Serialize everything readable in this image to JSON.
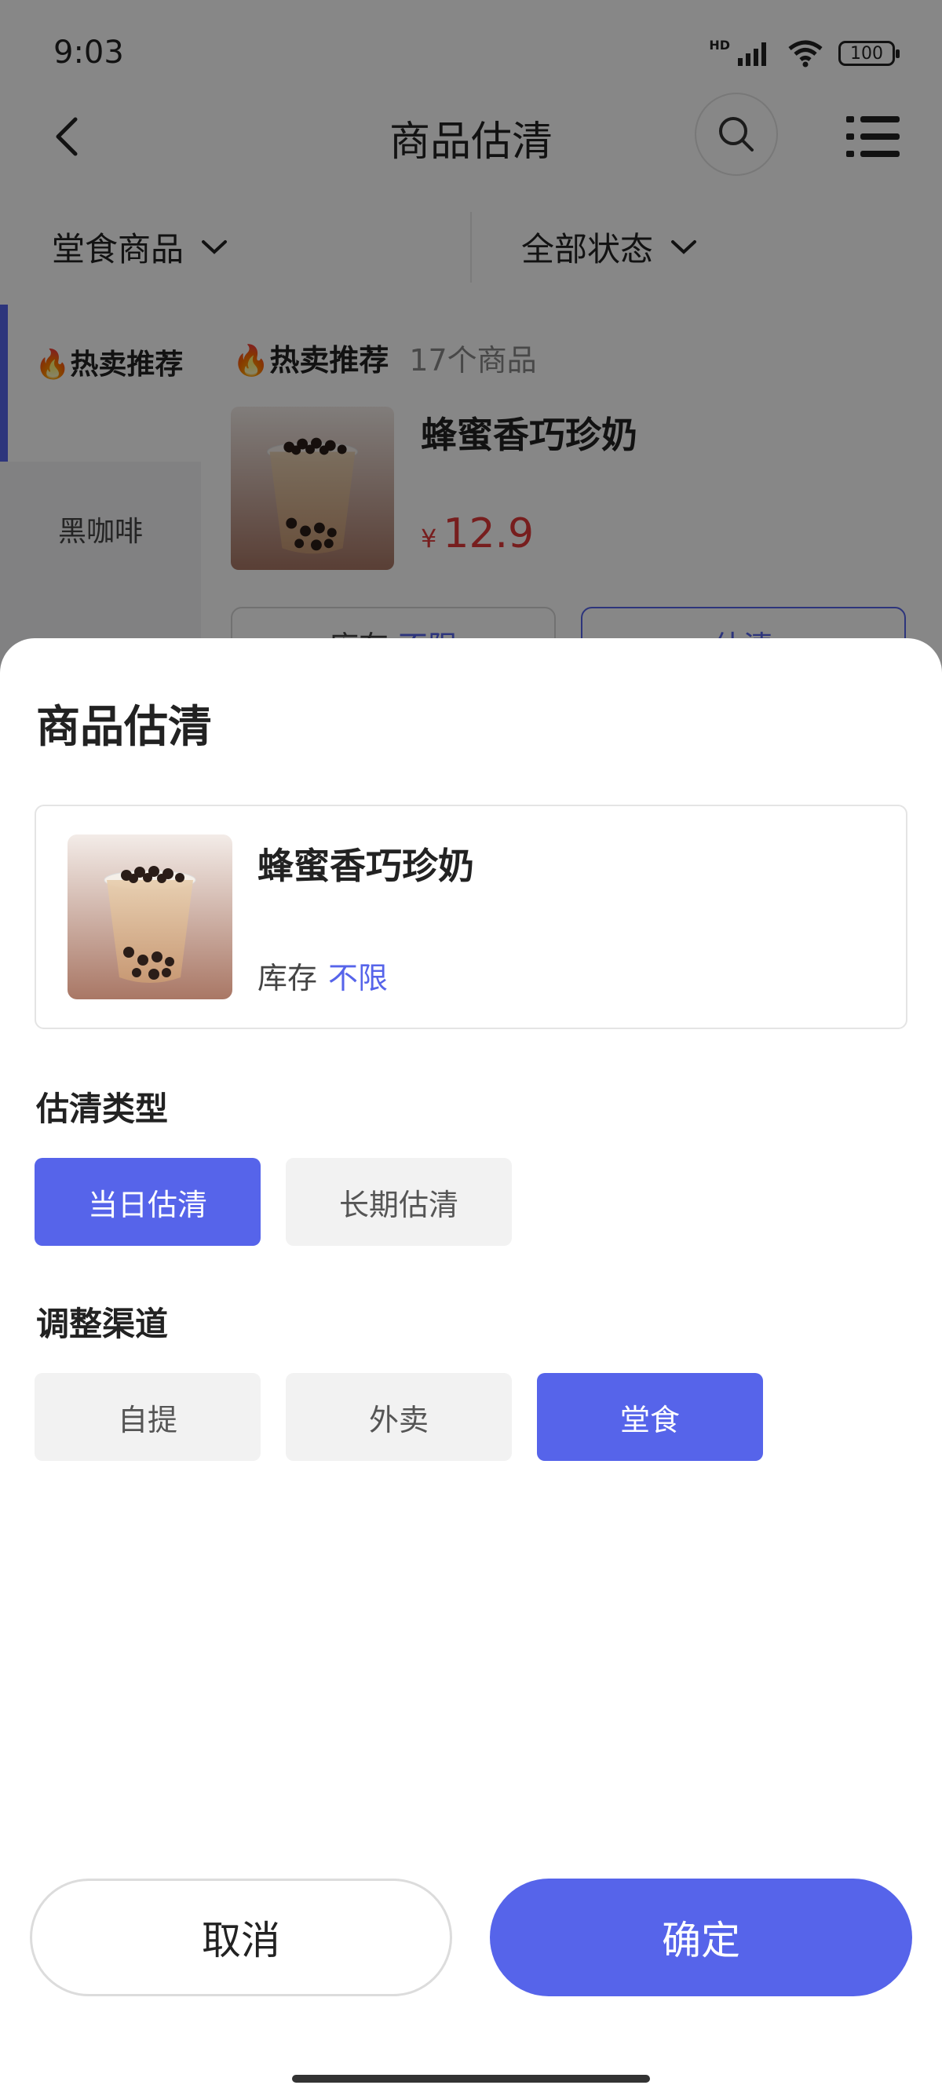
{
  "status_bar": {
    "time": "9:03",
    "hd_label": "HD",
    "battery": "100"
  },
  "nav": {
    "title": "商品估清"
  },
  "filters": {
    "scene": "堂食商品",
    "status": "全部状态"
  },
  "sidebar": {
    "items": [
      {
        "label": "🔥热卖推荐"
      },
      {
        "label": "黑咖啡"
      }
    ]
  },
  "list": {
    "section_title": "🔥热卖推荐",
    "count": "17个商品",
    "product": {
      "name": "蜂蜜香巧珍奶",
      "price_symbol": "¥",
      "price": "12.9",
      "stock_label": "库存",
      "stock_value": "不限",
      "sellout_label": "估清"
    }
  },
  "sheet": {
    "title": "商品估清",
    "product_name": "蜂蜜香巧珍奶",
    "stock_label": "库存",
    "stock_value": "不限",
    "type_label": "估清类型",
    "type_options": [
      {
        "label": "当日估清",
        "selected": true
      },
      {
        "label": "长期估清",
        "selected": false
      }
    ],
    "channel_label": "调整渠道",
    "channel_options": [
      {
        "label": "自提",
        "selected": false
      },
      {
        "label": "外卖",
        "selected": false
      },
      {
        "label": "堂食",
        "selected": true
      }
    ],
    "cancel_label": "取消",
    "confirm_label": "确定"
  },
  "colors": {
    "accent": "#5664ea",
    "price": "#e03a3a",
    "chip_off": "#f2f2f2"
  },
  "icons": [
    "back-icon",
    "search-icon",
    "menu-icon",
    "chevron-down-icon",
    "wifi-icon",
    "signal-icon",
    "battery-icon"
  ]
}
